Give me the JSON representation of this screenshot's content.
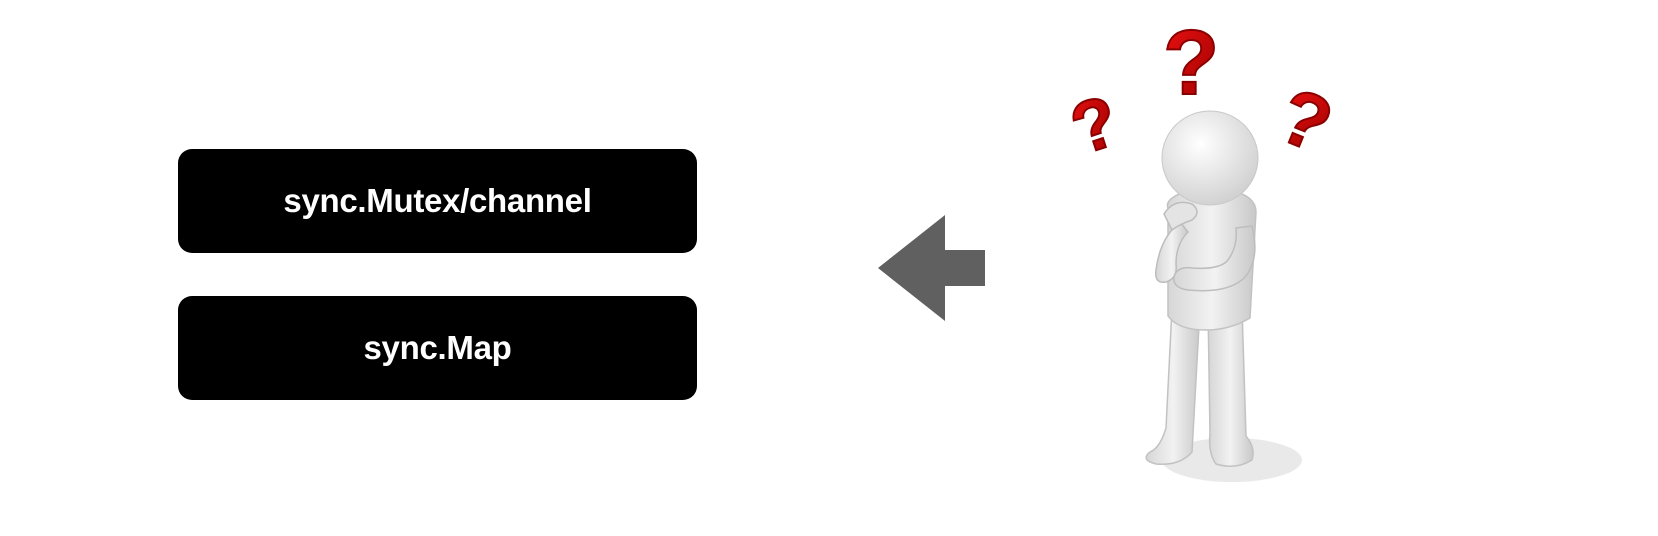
{
  "options": [
    {
      "label": "sync.Mutex/channel"
    },
    {
      "label": "sync.Map"
    }
  ],
  "arrow": {
    "icon": "arrow-left-icon",
    "color": "#606060"
  },
  "figure": {
    "icon": "confused-person-icon",
    "body_color": "#e6e6e6",
    "question_mark_color": "#d10000",
    "question_mark_icon": "question-mark-icon"
  }
}
